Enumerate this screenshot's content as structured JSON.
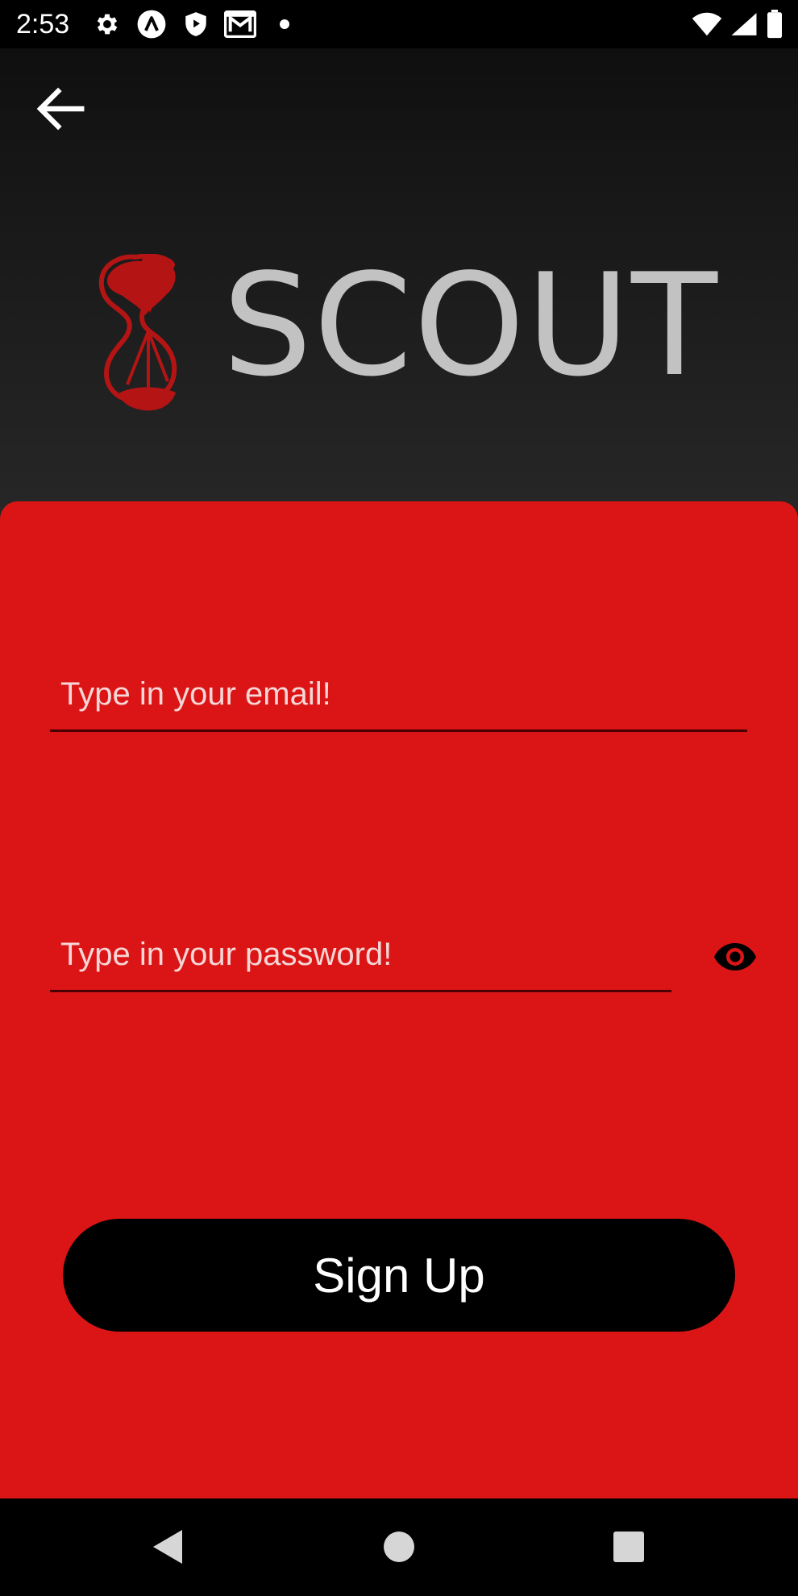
{
  "status_bar": {
    "time": "2:53",
    "left_icons": [
      "settings-gear-icon",
      "app-a-icon",
      "shield-play-icon",
      "gmail-icon",
      "notification-dot-icon"
    ],
    "right_icons": [
      "wifi-icon",
      "cell-signal-icon",
      "battery-icon"
    ]
  },
  "header": {
    "back_icon": "arrow-left-icon"
  },
  "logo": {
    "text": "SCOUT",
    "mark_color": "#b01313",
    "text_color": "#c2c2c2"
  },
  "form": {
    "email": {
      "placeholder": "Type in your email!",
      "value": ""
    },
    "password": {
      "placeholder": "Type in your password!",
      "value": "",
      "toggle_icon": "eye-icon"
    },
    "submit_label": "Sign Up"
  },
  "nav_bar": {
    "buttons": [
      "back-triangle-icon",
      "home-circle-icon",
      "recents-square-icon"
    ]
  },
  "colors": {
    "panel": "#db1515",
    "button": "#000000",
    "background_top": "#0c0c0c",
    "background_bottom": "#262626"
  }
}
